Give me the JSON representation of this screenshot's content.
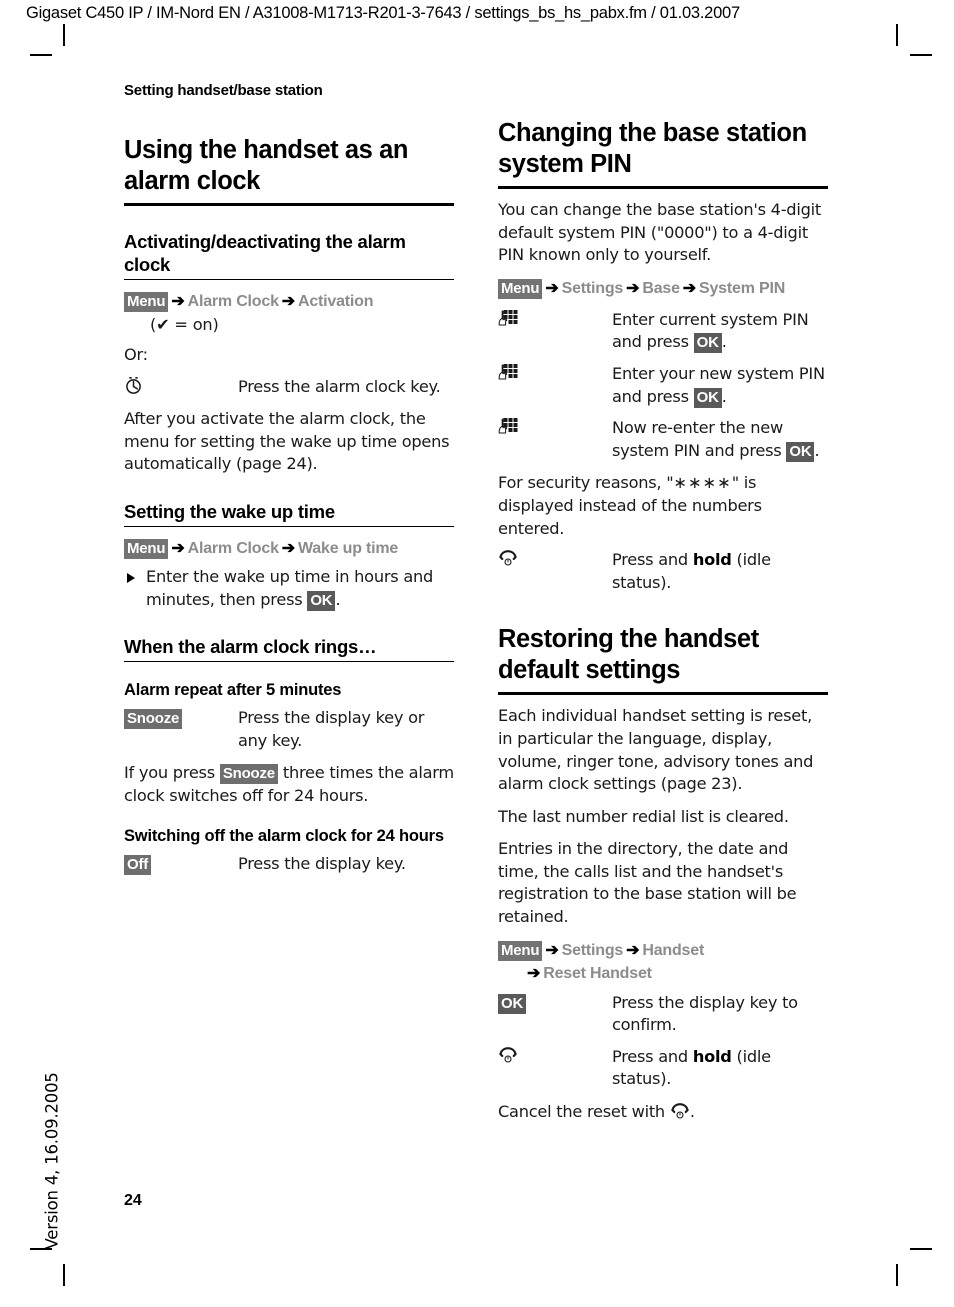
{
  "doc_header": "Gigaset C450 IP / IM-Nord EN / A31008-M1713-R201-3-7643 / settings_bs_hs_pabx.fm / 01.03.2007",
  "section_label": "Setting handset/base station",
  "footer": {
    "page_number": "24",
    "version": "Version 4, 16.09.2005"
  },
  "colors": {
    "key_badge_bg": "#6e6e6e",
    "key_badge_text": "#ffffff",
    "menu_path_text": "#8c8c8c",
    "arrow": "#000000",
    "rule": "#000000"
  },
  "left_column": {
    "chapter_title": "Using the handset as an alarm clock",
    "sections": [
      {
        "heading": "Activating/deactivating the alarm clock",
        "menu_path": {
          "badge": "Menu",
          "items": [
            "Alarm Clock",
            "Activation"
          ],
          "arrow": "➔",
          "note": "(✔ = on)"
        },
        "or_label": "Or:",
        "key_rows": [
          {
            "icon": "alarm-clock-key-icon",
            "text": "Press the alarm clock key."
          }
        ],
        "paragraph": "After you activate the alarm clock, the menu for setting the wake up time opens automatically (page 24)."
      },
      {
        "heading": "Setting the wake up time",
        "menu_path": {
          "badge": "Menu",
          "items": [
            "Alarm Clock",
            "Wake up time"
          ],
          "arrow": "➔"
        },
        "bullet_pre": "Enter the wake up time in hours and minutes, then press ",
        "bullet_badge": "OK",
        "bullet_post": "."
      },
      {
        "heading": "When the alarm clock rings…",
        "subheading_1": "Alarm repeat after 5 minutes",
        "snooze_badge": "Snooze",
        "snooze_text": "Press the display key or any key.",
        "snooze_para_pre": "If you press ",
        "snooze_para_badge": "Snooze",
        "snooze_para_post": " three times the alarm clock switches off for 24 hours.",
        "subheading_2": "Switching off the alarm clock for 24 hours",
        "off_badge": "Off",
        "off_text": "Press the display key."
      }
    ]
  },
  "right_column": {
    "sections": [
      {
        "chapter_title": "Changing the base station system PIN",
        "intro": "You can change the base station's 4-digit default system PIN (\"0000\") to a 4-digit PIN known only to yourself.",
        "menu_path": {
          "badge": "Menu",
          "items": [
            "Settings",
            "Base",
            "System PIN"
          ],
          "arrow": "➔"
        },
        "key_rows": [
          {
            "icon": "keypad-icon",
            "pre": "Enter current system PIN and press ",
            "badge": "OK",
            "post": "."
          },
          {
            "icon": "keypad-icon",
            "pre": "Enter your new system PIN and press ",
            "badge": "OK",
            "post": "."
          },
          {
            "icon": "keypad-icon",
            "pre": "Now re-enter the new system PIN and press ",
            "badge": "OK",
            "post": "."
          }
        ],
        "security_pre": "For security reasons, \"",
        "security_asterisks": "∗∗∗∗",
        "security_post": "\" is displayed instead of the numbers entered.",
        "end_key_row": {
          "icon": "end-call-key-icon",
          "pre": "Press and ",
          "bold": "hold",
          "post": " (idle status)."
        }
      },
      {
        "chapter_title": "Restoring the handset default settings",
        "paragraphs": [
          "Each individual handset setting is reset, in particular the language, display, volume, ringer tone, advisory tones and alarm clock settings (page 23).",
          "The last number redial list is cleared.",
          "Entries in the directory, the date and time, the calls list and the handset's registration to the base station will be retained."
        ],
        "menu_path": {
          "badge": "Menu",
          "items": [
            "Settings",
            "Handset"
          ],
          "items_line2": [
            "Reset Handset"
          ],
          "arrow": "➔"
        },
        "ok_row": {
          "badge": "OK",
          "text": "Press the display key to confirm."
        },
        "end_key_row": {
          "icon": "end-call-key-icon",
          "pre": "Press and ",
          "bold": "hold",
          "post": " (idle status)."
        },
        "cancel_pre": "Cancel the reset with ",
        "cancel_icon": "end-call-key-icon",
        "cancel_post": "."
      }
    ]
  }
}
